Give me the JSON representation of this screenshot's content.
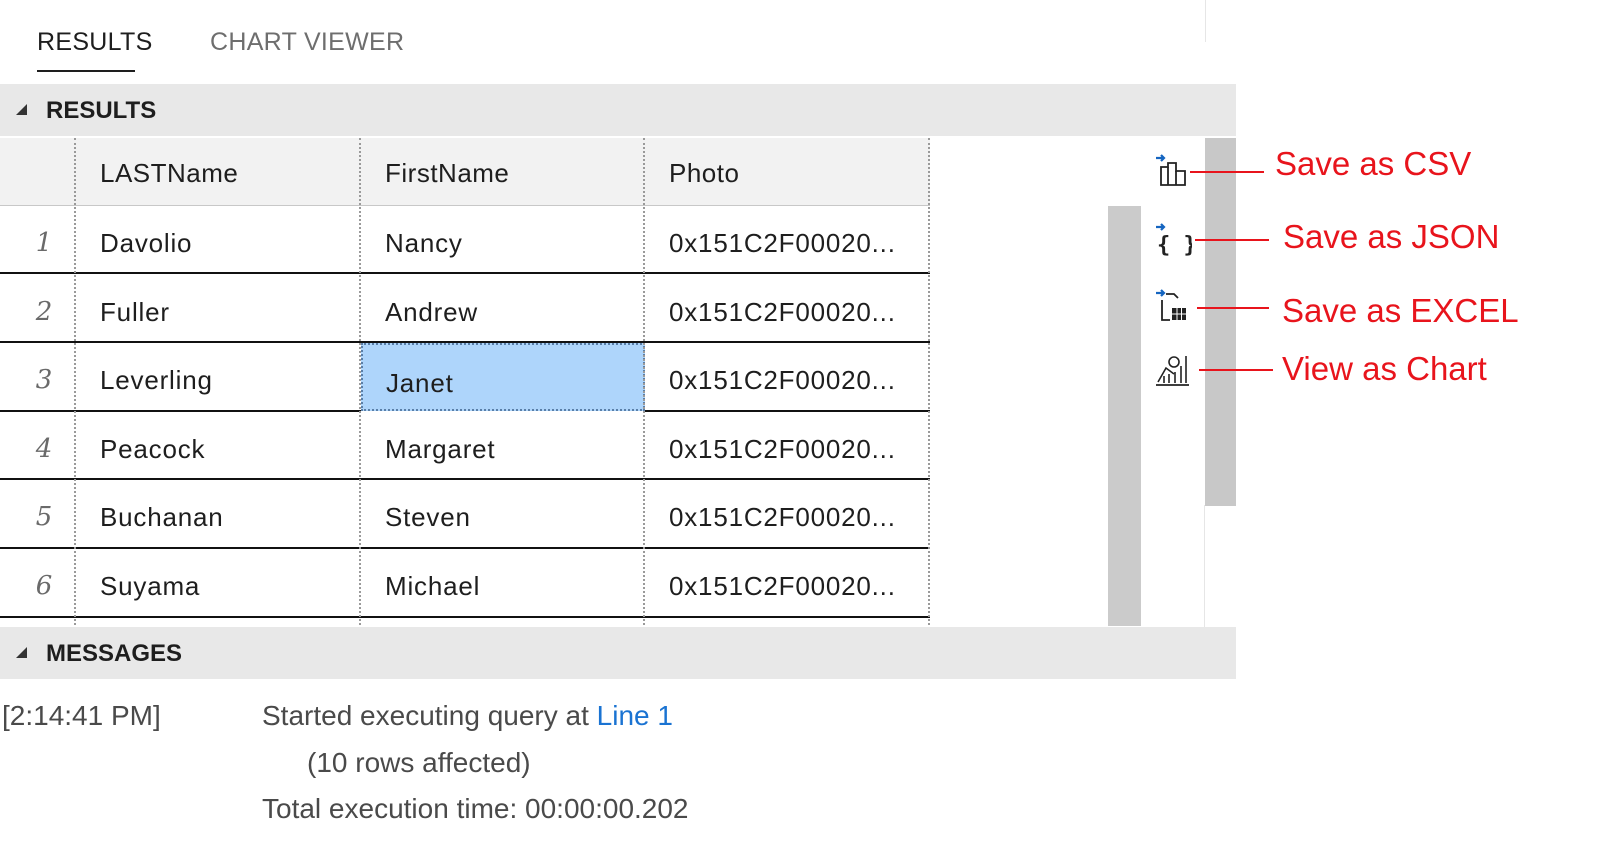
{
  "tabs": {
    "results": "RESULTS",
    "chart_viewer": "CHART VIEWER"
  },
  "results_section": {
    "title": "RESULTS"
  },
  "grid": {
    "columns": [
      "LASTName",
      "FirstName",
      "Photo"
    ],
    "rows": [
      {
        "num": "1",
        "last": "Davolio",
        "first": "Nancy",
        "photo": "0x151C2F00020..."
      },
      {
        "num": "2",
        "last": "Fuller",
        "first": "Andrew",
        "photo": "0x151C2F00020..."
      },
      {
        "num": "3",
        "last": "Leverling",
        "first": "Janet",
        "photo": "0x151C2F00020..."
      },
      {
        "num": "4",
        "last": "Peacock",
        "first": "Margaret",
        "photo": "0x151C2F00020..."
      },
      {
        "num": "5",
        "last": "Buchanan",
        "first": "Steven",
        "photo": "0x151C2F00020..."
      },
      {
        "num": "6",
        "last": "Suyama",
        "first": "Michael",
        "photo": "0x151C2F00020..."
      }
    ],
    "selected": {
      "row": "3",
      "column": "FirstName"
    }
  },
  "toolbar": {
    "icons": [
      "save-csv-icon",
      "save-json-icon",
      "save-excel-icon",
      "view-chart-icon"
    ],
    "accent_color": "#1565c0"
  },
  "annotations": {
    "color": "#e8141c",
    "save_csv": "Save as CSV",
    "save_json": "Save as JSON",
    "save_excel": "Save as EXCEL",
    "view_chart": "View as Chart"
  },
  "messages_section": {
    "title": "MESSAGES",
    "timestamp": "[2:14:41 PM]",
    "started_text": "Started executing query at",
    "line_link": "Line 1",
    "rows_affected": "(10 rows affected)",
    "execution_time": "Total execution time: 00:00:00.202"
  }
}
